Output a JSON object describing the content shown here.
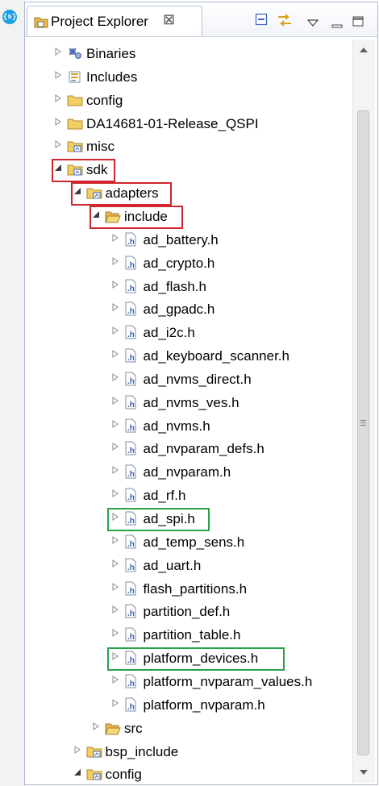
{
  "panel": {
    "title": "Project Explorer",
    "close_symbol": "⊠",
    "tab_icon": "project-folder-icon",
    "side_icon_text": "{s}"
  },
  "toolbar": {
    "collapse_all_icon": "collapse-all-icon",
    "link_editor_icon": "link-with-editor-icon",
    "view_menu_icon": "view-menu-icon",
    "minimize_icon": "minimize-icon",
    "maximize_icon": "maximize-icon"
  },
  "tree": [
    {
      "label": "Binaries",
      "icon": "binaries-icon",
      "state": "collapsed",
      "indent": 0
    },
    {
      "label": "Includes",
      "icon": "includes-icon",
      "state": "collapsed",
      "indent": 0
    },
    {
      "label": "config",
      "icon": "folder-icon",
      "state": "collapsed",
      "indent": 0
    },
    {
      "label": "DA14681-01-Release_QSPI",
      "icon": "folder-icon",
      "state": "collapsed",
      "indent": 0
    },
    {
      "label": "misc",
      "icon": "source-folder-icon",
      "state": "collapsed",
      "indent": 0
    },
    {
      "label": "sdk",
      "icon": "source-folder-icon",
      "state": "expanded",
      "indent": 0,
      "highlight": "red"
    },
    {
      "label": "adapters",
      "icon": "source-folder-icon",
      "state": "expanded",
      "indent": 1,
      "highlight": "red"
    },
    {
      "label": "include",
      "icon": "open-folder-icon",
      "state": "expanded",
      "indent": 2,
      "highlight": "red"
    },
    {
      "label": "ad_battery.h",
      "icon": "header-file-icon",
      "state": "collapsed",
      "indent": 3
    },
    {
      "label": "ad_crypto.h",
      "icon": "header-file-icon",
      "state": "collapsed",
      "indent": 3
    },
    {
      "label": "ad_flash.h",
      "icon": "header-file-icon",
      "state": "collapsed",
      "indent": 3
    },
    {
      "label": "ad_gpadc.h",
      "icon": "header-file-icon",
      "state": "collapsed",
      "indent": 3
    },
    {
      "label": "ad_i2c.h",
      "icon": "header-file-icon",
      "state": "collapsed",
      "indent": 3
    },
    {
      "label": "ad_keyboard_scanner.h",
      "icon": "header-file-icon",
      "state": "collapsed",
      "indent": 3
    },
    {
      "label": "ad_nvms_direct.h",
      "icon": "header-file-icon",
      "state": "collapsed",
      "indent": 3
    },
    {
      "label": "ad_nvms_ves.h",
      "icon": "header-file-icon",
      "state": "collapsed",
      "indent": 3
    },
    {
      "label": "ad_nvms.h",
      "icon": "header-file-icon",
      "state": "collapsed",
      "indent": 3
    },
    {
      "label": "ad_nvparam_defs.h",
      "icon": "header-file-icon",
      "state": "collapsed",
      "indent": 3
    },
    {
      "label": "ad_nvparam.h",
      "icon": "header-file-icon",
      "state": "collapsed",
      "indent": 3
    },
    {
      "label": "ad_rf.h",
      "icon": "header-file-icon",
      "state": "collapsed",
      "indent": 3
    },
    {
      "label": "ad_spi.h",
      "icon": "header-file-icon",
      "state": "collapsed",
      "indent": 3,
      "highlight": "green"
    },
    {
      "label": "ad_temp_sens.h",
      "icon": "header-file-icon",
      "state": "collapsed",
      "indent": 3
    },
    {
      "label": "ad_uart.h",
      "icon": "header-file-icon",
      "state": "collapsed",
      "indent": 3
    },
    {
      "label": "flash_partitions.h",
      "icon": "header-file-icon",
      "state": "collapsed",
      "indent": 3
    },
    {
      "label": "partition_def.h",
      "icon": "header-file-icon",
      "state": "collapsed",
      "indent": 3
    },
    {
      "label": "partition_table.h",
      "icon": "header-file-icon",
      "state": "collapsed",
      "indent": 3
    },
    {
      "label": "platform_devices.h",
      "icon": "header-file-icon",
      "state": "collapsed",
      "indent": 3,
      "highlight": "green"
    },
    {
      "label": "platform_nvparam_values.h",
      "icon": "header-file-icon",
      "state": "collapsed",
      "indent": 3
    },
    {
      "label": "platform_nvparam.h",
      "icon": "header-file-icon",
      "state": "collapsed",
      "indent": 3
    },
    {
      "label": "src",
      "icon": "open-folder-icon",
      "state": "collapsed",
      "indent": 2
    },
    {
      "label": "bsp_include",
      "icon": "source-folder-icon",
      "state": "collapsed",
      "indent": 1
    },
    {
      "label": "config",
      "icon": "source-folder-icon",
      "state": "expanded",
      "indent": 1
    }
  ],
  "colors": {
    "highlight_red": "#d0262d",
    "highlight_green": "#27a14a",
    "folder": "#e9b949",
    "header_badge": "#3b63b6"
  }
}
